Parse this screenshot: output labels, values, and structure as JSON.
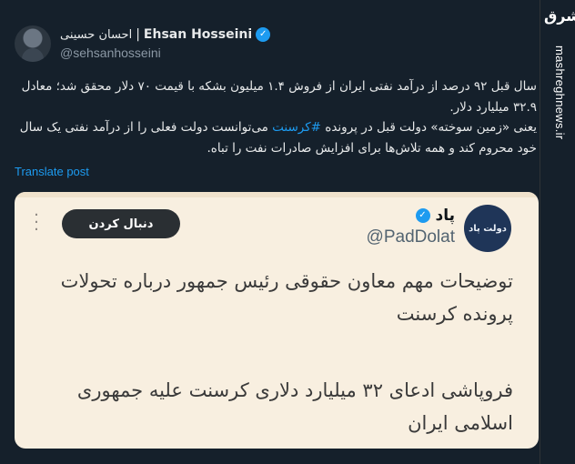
{
  "author": {
    "name_fa": "احسان حسینی",
    "separator": "|",
    "name_en": "Ehsan Hosseini",
    "handle": "@sehsanhosseini"
  },
  "post": {
    "paragraph1": "سال قبل ۹۲ درصد از درآمد نفتی ایران از فروش ۱.۴ میلیون بشکه با قیمت ۷۰ دلار محقق شد؛ معادل ۳۲.۹ میلیارد دلار.",
    "paragraph2_part1": "یعنی «زمین سوخته» دولت قبل در پرونده ",
    "hashtag": "#کرسنت",
    "paragraph2_part2": " می‌توانست دولت فعلی را از درآمد نفتی یک سال خود محروم کند و همه تلاش‌ها برای افزایش صادرات نفت را تباه."
  },
  "translate_label": "Translate post",
  "quote": {
    "name": "پاد",
    "handle": "@PadDolat",
    "avatar_text": "دولت پاد",
    "follow_label": "دنبال کردن",
    "headline1": "توضیحات مهم معاون حقوقی رئیس جمهور درباره تحولات پرونده کرسنت",
    "headline2": "فروپاشی ادعای ۳۲ میلیارد دلاری کرسنت علیه جمهوری اسلامی ایران"
  },
  "watermark": {
    "logo": "مشرق",
    "site": "mashreghnews.ir"
  },
  "colors": {
    "background": "#15202b",
    "accent": "#1d9bf0",
    "card_bg": "#f8efe0",
    "follow_button": "#2a2f33"
  }
}
